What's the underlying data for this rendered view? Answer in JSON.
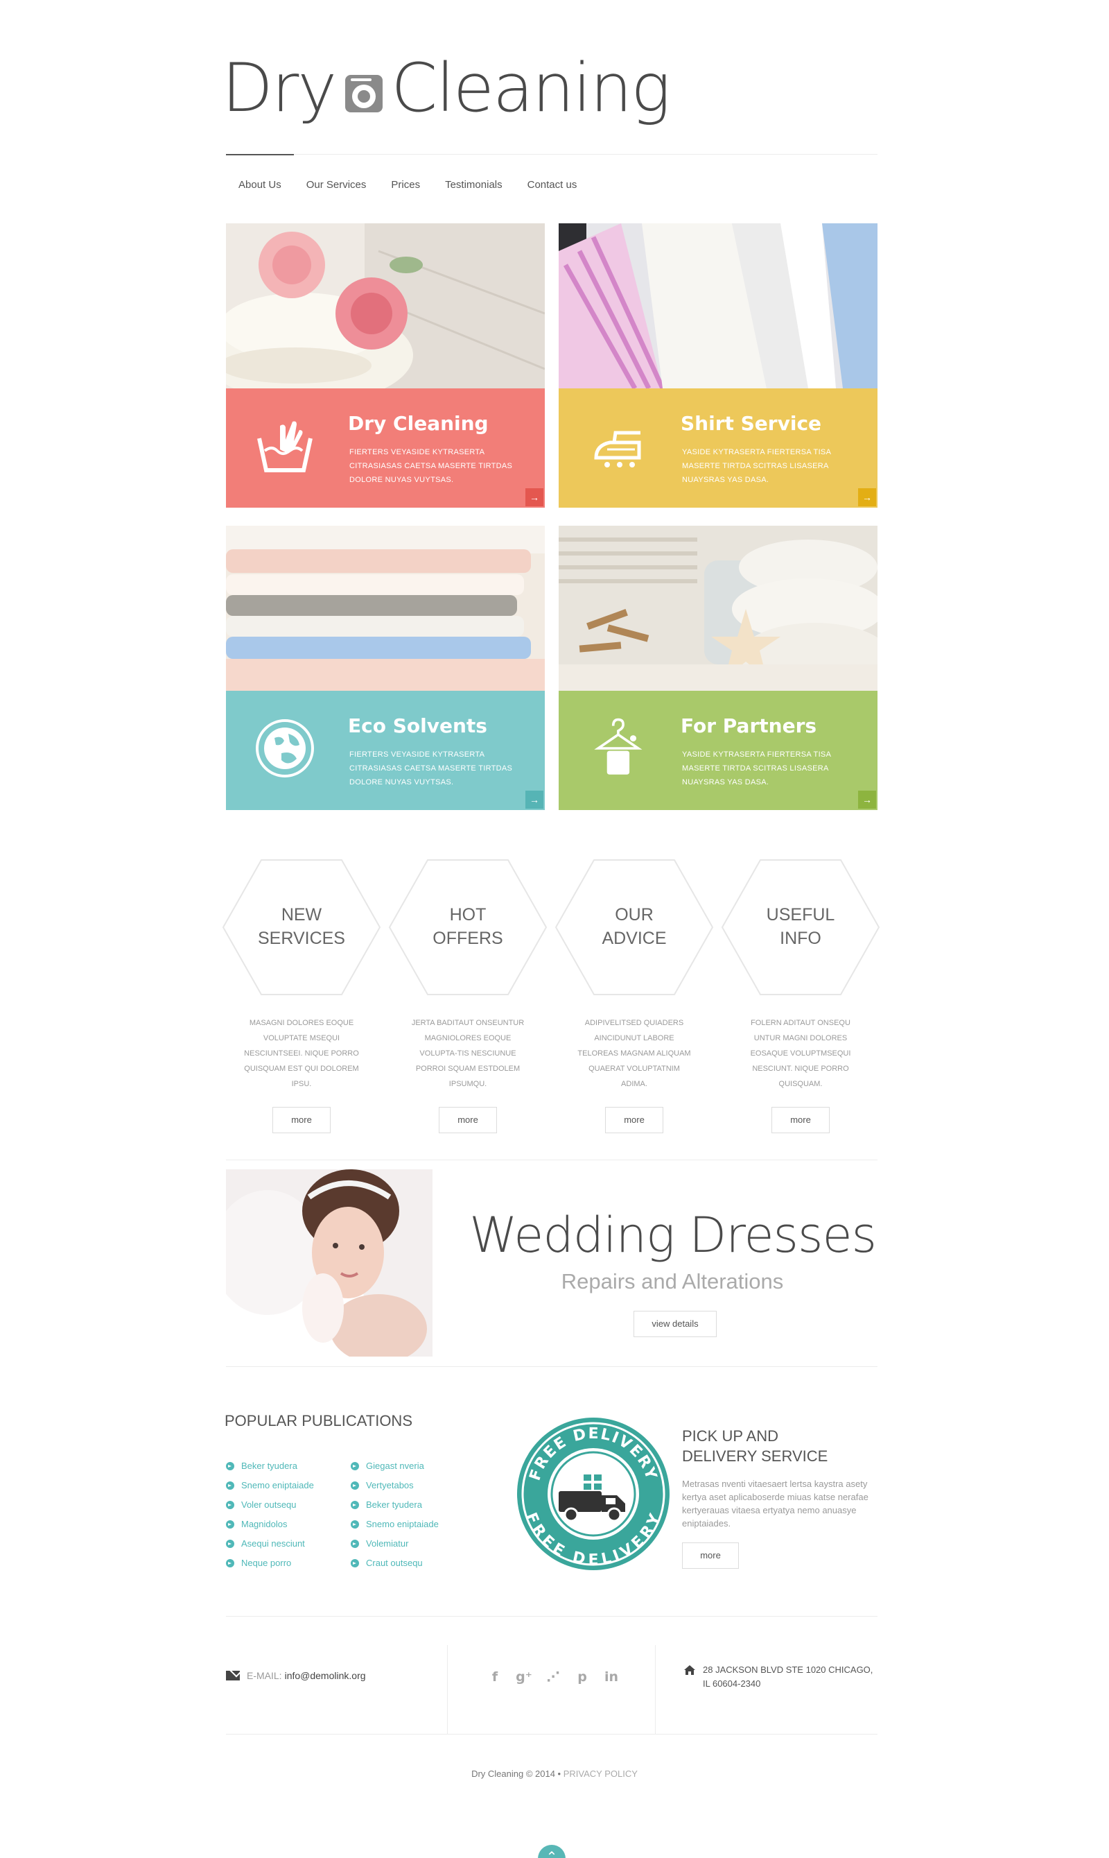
{
  "header": {
    "logo_word1": "Dry",
    "logo_word2": "Cleaning",
    "nav": [
      "About Us",
      "Our Services",
      "Prices",
      "Testimonials",
      "Contact us"
    ]
  },
  "tiles": [
    {
      "title": "Dry Cleaning",
      "text": "FIERTERS VEYASIDE KYTRASERTA CITRASIASAS CAETSA MASERTE TIRTDAS DOLORE NUYAS VUYTSAS.",
      "color": "#f27e78",
      "icon": "hand-wash-icon"
    },
    {
      "title": "Shirt Service",
      "text": "YASIDE KYTRASERTA FIERTERSA TISA MASERTE TIRTDA SCITRAS LISASERA NUAYSRAS YAS DASA.",
      "color": "#edc85a",
      "icon": "iron-icon"
    },
    {
      "title": "Eco Solvents",
      "text": "FIERTERS VEYASIDE KYTRASERTA CITRASIASAS CAETSA MASERTE TIRTDAS DOLORE NUYAS VUYTSAS.",
      "color": "#7fcacb",
      "icon": "globe-icon"
    },
    {
      "title": "For Partners",
      "text": "YASIDE KYTRASERTA FIERTERSA TISA MASERTE TIRTDA SCITRAS LISASERA NUAYSRAS YAS DASA.",
      "color": "#a9c96a",
      "icon": "hanger-icon"
    }
  ],
  "features": [
    {
      "label_l1": "NEW",
      "label_l2": "SERVICES",
      "text": "MASAGNI DOLORES EOQUE VOLUPTATE MSEQUI NESCIUNTSEEI. NIQUE PORRO QUISQUAM EST QUI DOLOREM IPSU.",
      "button": "more"
    },
    {
      "label_l1": "HOT",
      "label_l2": "OFFERS",
      "text": "JERTA BADITAUT ONSEUNTUR MAGNIOLORES EOQUE VOLUPTA-TIS NESCIUNUE PORROI SQUAM ESTDOLEM IPSUMQU.",
      "button": "more"
    },
    {
      "label_l1": "OUR",
      "label_l2": "ADVICE",
      "text": "ADIPIVELITSED QUIADERS AINCIDUNUT LABORE TELOREAS MAGNAM ALIQUAM QUAERAT VOLUPTATNIM ADIMA.",
      "button": "more"
    },
    {
      "label_l1": "USEFUL",
      "label_l2": "INFO",
      "text": "FOLERN ADITAUT ONSEQU UNTUR MAGNI DOLORES EOSAQUE VOLUPTMSEQUI NESCIUNT. NIQUE PORRO QUISQUAM.",
      "button": "more"
    }
  ],
  "wedding": {
    "title": "Wedding Dresses",
    "subtitle": "Repairs and Alterations",
    "button": "view details"
  },
  "publications": {
    "title": "POPULAR PUBLICATIONS",
    "col1": [
      "Beker tyudera",
      "Snemo eniptaiade",
      "Voler outsequ",
      "Magnidolos",
      "Asequi nesciunt",
      "Neque porro"
    ],
    "col2": [
      "Giegast nveria",
      "Vertyetabos",
      "Beker tyudera",
      "Snemo eniptaiade",
      "Volemiatur",
      "Craut outsequ"
    ]
  },
  "delivery": {
    "stamp_text": "FREE DELIVERY",
    "title_l1": "PICK UP AND",
    "title_l2": "DELIVERY SERVICE",
    "text": "Metrasas nventi vitaesaert lertsa kaystra asety kertya aset aplicaboserde miuas katse nerafae kertyerauas vitaesa ertyatya nemo anuasye eniptaiades.",
    "button": "more"
  },
  "footer": {
    "email_label": "E-MAIL:",
    "email": "info@demolink.org",
    "social": [
      "facebook-icon",
      "google-plus-icon",
      "rss-icon",
      "pinterest-icon",
      "linkedin-icon"
    ],
    "social_glyphs": [
      "f",
      "g⁺",
      "⋰",
      "p",
      "in"
    ],
    "address_l1": "28 JACKSON BLVD STE 1020 CHICAGO,",
    "address_l2": "IL 60604-2340",
    "copyright": "Dry Cleaning © 2014 •",
    "privacy": "PRIVACY POLICY"
  }
}
